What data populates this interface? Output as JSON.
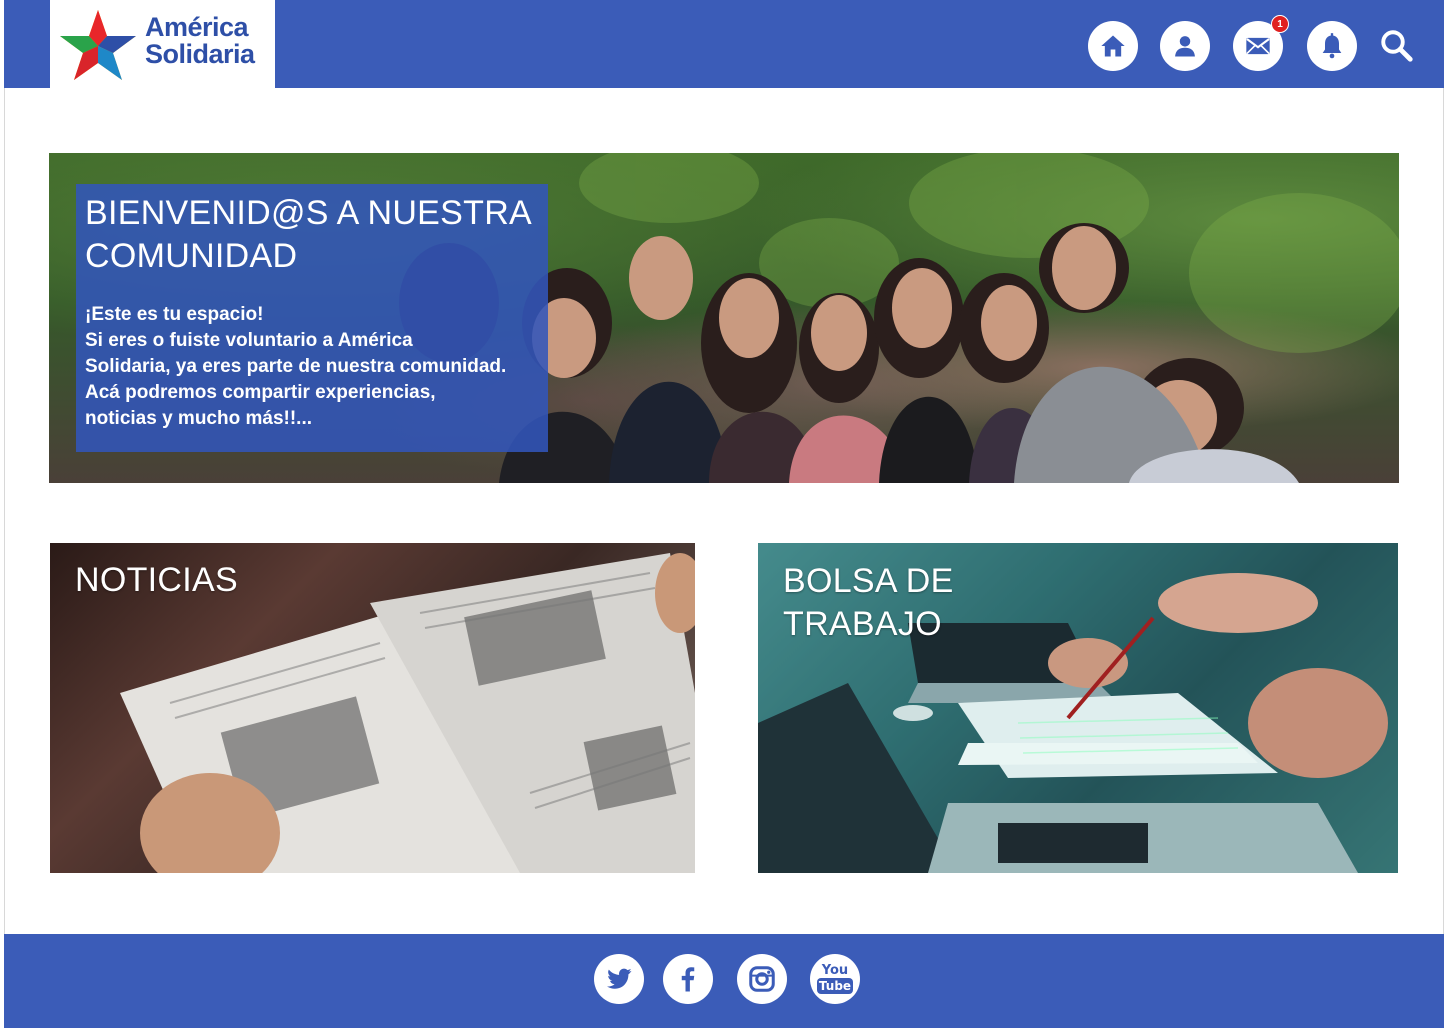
{
  "brand": {
    "name_line1": "América",
    "name_line2": "Solidaria",
    "color": "#3b5cb8"
  },
  "header": {
    "icons": [
      "home-icon",
      "user-icon",
      "mail-icon",
      "bell-icon",
      "search-icon"
    ],
    "mail_badge": "1"
  },
  "hero": {
    "title": "BIENVENID@S A NUESTRA COMUNIDAD",
    "text_lines": [
      "¡Este es tu espacio!",
      "Si eres o fuiste voluntario a América",
      "Solidaria, ya eres parte de nuestra comunidad.",
      "Acá podremos compartir experiencias,",
      "noticias y mucho más!!..."
    ]
  },
  "cards": {
    "news_title": "NOTICIAS",
    "jobs_title_line1": "BOLSA DE",
    "jobs_title_line2": "TRABAJO"
  },
  "footer": {
    "social": [
      "twitter-icon",
      "facebook-icon",
      "instagram-icon",
      "youtube-icon"
    ],
    "youtube_top": "You",
    "youtube_bottom": "Tube"
  }
}
